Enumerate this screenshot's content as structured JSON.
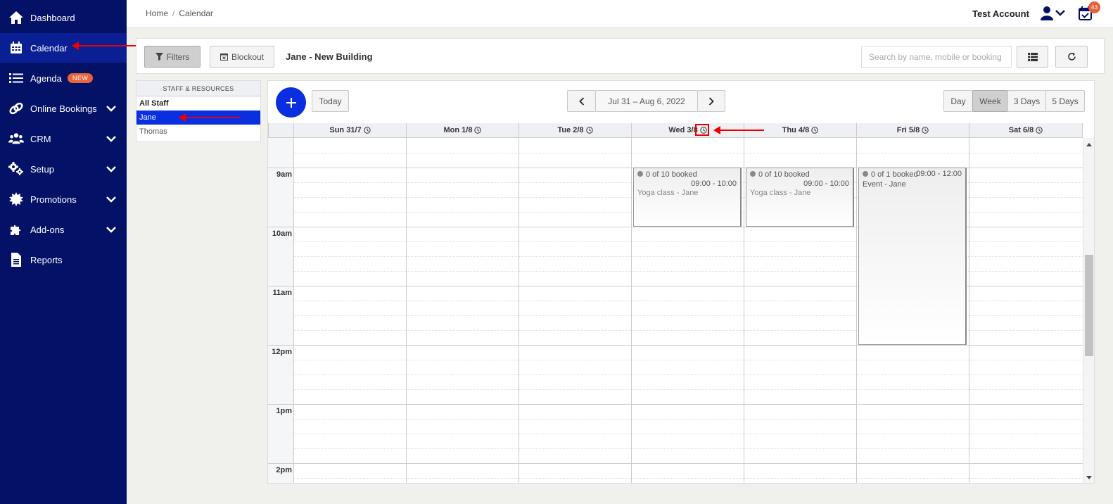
{
  "sidebar": {
    "items": [
      {
        "label": "Dashboard",
        "icon": "home-icon"
      },
      {
        "label": "Calendar",
        "icon": "calendar-icon",
        "active": true
      },
      {
        "label": "Agenda",
        "icon": "list-icon",
        "badge": "NEW"
      },
      {
        "label": "Online Bookings",
        "icon": "link-icon",
        "expandable": true
      },
      {
        "label": "CRM",
        "icon": "users-icon",
        "expandable": true
      },
      {
        "label": "Setup",
        "icon": "gears-icon",
        "expandable": true
      },
      {
        "label": "Promotions",
        "icon": "starburst-icon",
        "expandable": true
      },
      {
        "label": "Add-ons",
        "icon": "puzzle-icon",
        "expandable": true
      },
      {
        "label": "Reports",
        "icon": "document-icon"
      }
    ]
  },
  "topbar": {
    "breadcrumb": [
      "Home",
      "Calendar"
    ],
    "account": "Test Account",
    "notification_count": "43"
  },
  "toolbar": {
    "filters_label": "Filters",
    "blockout_label": "Blockout",
    "title": "Jane - New Building",
    "search_placeholder": "Search by name, mobile or booking ID"
  },
  "staff": {
    "header": "STAFF & RESOURCES",
    "items": [
      {
        "label": "All Staff",
        "bold": true
      },
      {
        "label": "Jane",
        "selected": true
      },
      {
        "label": "Thomas"
      }
    ]
  },
  "calendar": {
    "today_label": "Today",
    "range_label": "Jul 31 – Aug 6, 2022",
    "views": [
      "Day",
      "Week",
      "3 Days",
      "5 Days"
    ],
    "active_view": "Week",
    "days": [
      "Sun 31/7",
      "Mon 1/8",
      "Tue 2/8",
      "Wed 3/8",
      "Thu 4/8",
      "Fri 5/8",
      "Sat 6/8"
    ],
    "hours": [
      "9am",
      "10am",
      "11am",
      "12pm",
      "1pm",
      "2pm"
    ],
    "events": [
      {
        "day": "Wed 3/8",
        "booked": "0 of 10 booked",
        "time": "09:00 - 10:00",
        "name": "Yoga class - Jane"
      },
      {
        "day": "Thu 4/8",
        "booked": "0 of 10 booked",
        "time": "09:00 - 10:00",
        "name": "Yoga class - Jane"
      },
      {
        "day": "Fri 5/8",
        "booked": "0 of 1 booked",
        "time": "09:00 - 12:00",
        "name": "Event - Jane"
      }
    ]
  },
  "colors": {
    "sidebar_bg": "#031266",
    "sidebar_active": "#0a1f94",
    "accent_blue": "#0a2fe0",
    "badge_orange": "#e8623a",
    "annotation_red": "#e00000"
  }
}
